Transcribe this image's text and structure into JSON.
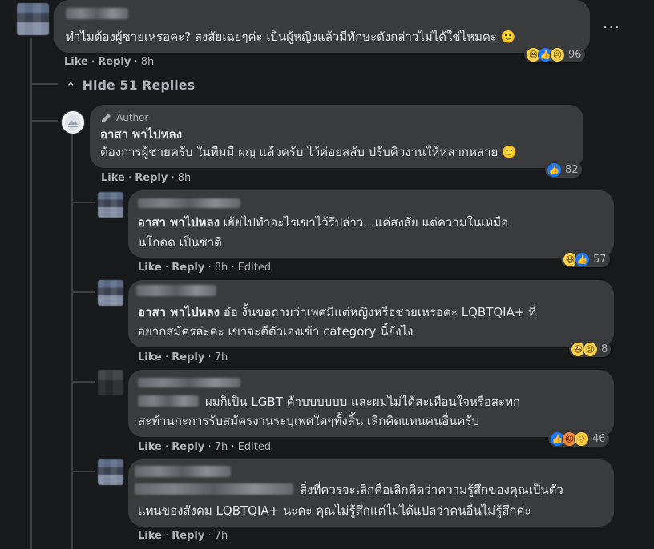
{
  "top_comment": {
    "text": "ทำไมต้องผู้ชายเหรอคะ? สงสัยเฉยๆค่ะ เป็นผู้หญิงแล้วมีทักษะดังกล่าวไม่ได้ใช่ไหมคะ 🙂",
    "like": "Like",
    "reply": "Reply",
    "time": "8h",
    "reaction_count": "96",
    "more": "···"
  },
  "hide_replies": {
    "label": "Hide 51 Replies",
    "chevron": "⌃"
  },
  "author_comment": {
    "badge": "Author",
    "name": "อาสา พาไปหลง",
    "text": "ต้องการผู้ชายครับ ในทีมมี ผญ แล้วครับ ไว้ค่อยสลับ ปรับคิวงานให้หลากหลาย 🙂",
    "like": "Like",
    "reply": "Reply",
    "time": "8h",
    "reaction_count": "82"
  },
  "replies": [
    {
      "mention": "อาสา พาไปหลง",
      "line1": " เฮ้ยไปทำอะไรเขาไว้รึปล่าว...แค่สงสัย แต่ความในเหมือ",
      "line2": "นโกดด เป็นชาติ",
      "like": "Like",
      "reply": "Reply",
      "time": "8h",
      "edited": "Edited",
      "reaction_count": "57"
    },
    {
      "mention": "อาสา พาไปหลง",
      "line1": " อ๋อ งั้นขอถามว่าเพศมีแต่หญิงหรือชายเหรอคะ LQBTQIA+ ที่",
      "line2": "อยากสมัครล่ะคะ เขาจะตีตัวเองเข้า category นี้ยังไง",
      "like": "Like",
      "reply": "Reply",
      "time": "7h",
      "reaction_count": "8"
    },
    {
      "line1": "ผมก็เป็น LGBT ค้าบบบบบบ และผมไม่ได้สะเทือนใจหรือสะทก",
      "line2": "สะท้านกะการรับสมัครงานระบุเพศใดๆทั้งสิ้น เลิกคิดแทนคนอื่นครับ",
      "like": "Like",
      "reply": "Reply",
      "time": "7h",
      "edited": "Edited",
      "reaction_count": "46"
    },
    {
      "line1": "สิ่งที่ควรจะเลิกคือเลิกคิดว่าความรู้สึกของคุณเป็นตัว",
      "line2": "แทนของสังคม LQBTQIA+ นะคะ คุณไม่รู้สึกแต่ไม่ได้แปลว่าคนอื่นไม่รู้สึกค่ะ",
      "like": "Like",
      "reply": "Reply",
      "time": "7h"
    }
  ],
  "separator": "·",
  "emoji": {
    "like": "👍",
    "haha": "😆",
    "sad": "😢",
    "care": "🤗",
    "angry": "😡"
  },
  "colors": {
    "background": "#18191a",
    "bubble": "#3a3b3c",
    "text": "#e4e6eb",
    "muted": "#b0b3b8",
    "like_blue": "#2078f4"
  }
}
